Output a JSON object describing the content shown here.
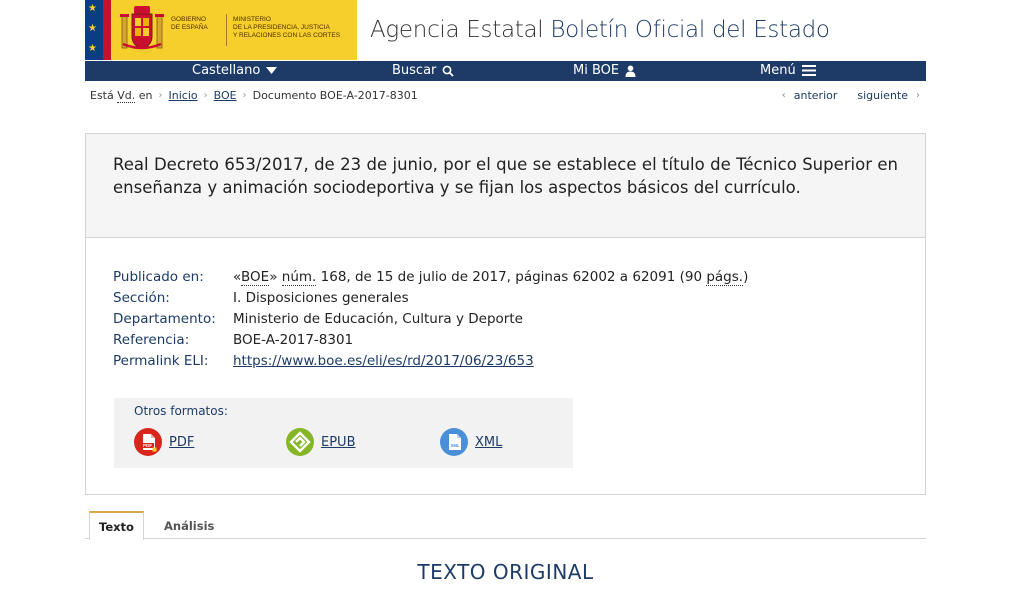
{
  "header": {
    "gov_label": "GOBIERNO\nDE ESPAÑA",
    "ministry_label": "MINISTERIO\nDE LA PRESIDENCIA, JUSTICIA\nY RELACIONES CON LAS CORTES",
    "site_title_prefix": "Agencia Estatal",
    "site_title_main": "Boletín Oficial del Estado",
    "colors": {
      "brand_blue": "#1d3b66",
      "gov_yellow": "#f7cf2c",
      "eu_blue": "#0d3c87",
      "red": "#c8102e"
    }
  },
  "nav": {
    "items": [
      {
        "label": "Castellano",
        "icon": "caret-down-icon"
      },
      {
        "label": "Buscar",
        "icon": "search-icon"
      },
      {
        "label": "Mi BOE",
        "icon": "user-icon"
      },
      {
        "label": "Menú",
        "icon": "hamburger-icon"
      }
    ]
  },
  "breadcrumb": {
    "prefix_a": "Está",
    "prefix_abbr": "Vd.",
    "prefix_b": "en",
    "items": [
      "Inicio",
      "BOE"
    ],
    "current": "Documento BOE-A-2017-8301"
  },
  "pager": {
    "prev": "anterior",
    "next": "siguiente"
  },
  "document": {
    "title": "Real Decreto 653/2017, de 23 de junio, por el que se establece el título de Técnico Superior en enseñanza y animación sociodeportiva y se fijan los aspectos básicos del currículo.",
    "published_label": "Publicado en:",
    "published_open": "«",
    "published_boe": "BOE",
    "published_close": "» ",
    "published_num": "núm.",
    "published_rest": " 168, de 15 de julio de 2017, páginas 62002 a 62091 (90 ",
    "published_pags": "págs.",
    "published_end": ")",
    "section_label": "Sección:",
    "section_value": "I. Disposiciones generales",
    "department_label": "Departamento:",
    "department_value": "Ministerio de Educación, Cultura y Deporte",
    "reference_label": "Referencia:",
    "reference_value": "BOE-A-2017-8301",
    "eli_label": "Permalink ELI:",
    "eli_value": "https://www.boe.es/eli/es/rd/2017/06/23/653"
  },
  "formats": {
    "title": "Otros formatos:",
    "items": [
      {
        "label": "PDF",
        "icon": "pdf-icon"
      },
      {
        "label": "EPUB",
        "icon": "epub-icon"
      },
      {
        "label": "XML",
        "icon": "xml-icon"
      }
    ]
  },
  "tabs": {
    "active": "Texto",
    "inactive": "Análisis"
  },
  "content": {
    "heading": "TEXTO ORIGINAL"
  }
}
